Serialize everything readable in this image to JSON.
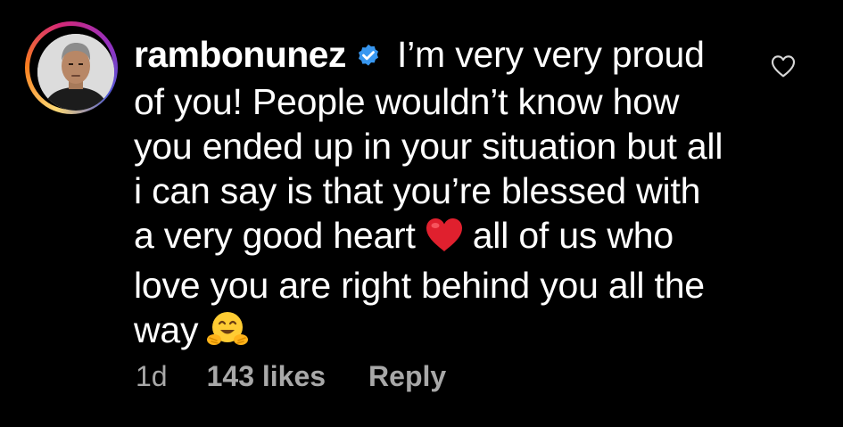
{
  "comment": {
    "username": "rambonunez",
    "verified": true,
    "text_lines": [
      "I’m very very proud",
      "of you! People wouldn’t know how",
      "you ended up in your situation but all",
      "i can say is that you’re blessed with",
      "a very good heart",
      "all of us who",
      "love you are right behind you all the",
      "way"
    ],
    "emojis": [
      "red-heart",
      "hugging-face"
    ],
    "meta": {
      "time": "1d",
      "likes": "143 likes",
      "reply_label": "Reply"
    }
  },
  "colors": {
    "background": "#000000",
    "text": "#ffffff",
    "meta_text": "#a8a8a8",
    "verified_badge": "#3897f0",
    "heart": "#e0202e"
  },
  "icons": {
    "like": "heart-outline-icon",
    "verified": "verified-badge-icon"
  }
}
